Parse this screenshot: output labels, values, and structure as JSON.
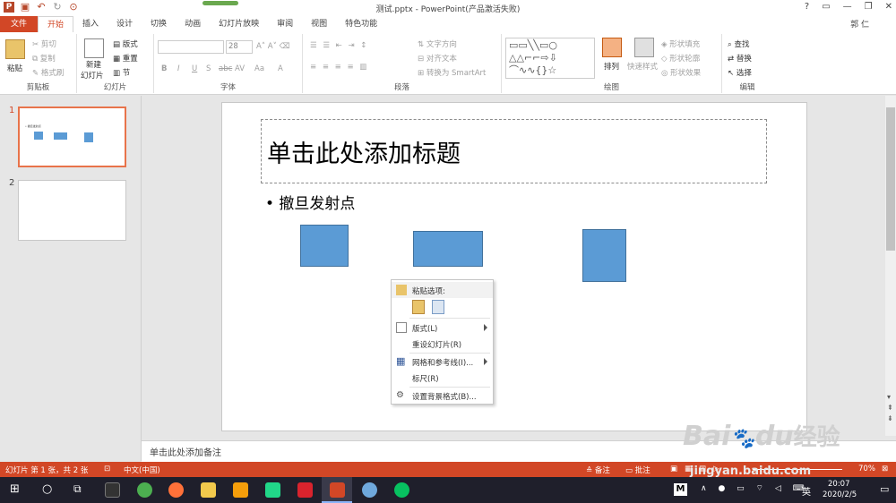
{
  "window": {
    "title": "测试.pptx - PowerPoint(产品激活失败)",
    "user": "郭 仁",
    "help": "?",
    "minimize": "—",
    "restore": "❐",
    "close": "✕"
  },
  "tabs": [
    "文件",
    "开始",
    "插入",
    "设计",
    "切换",
    "动画",
    "幻灯片放映",
    "审阅",
    "视图",
    "特色功能"
  ],
  "ribbon": {
    "clipboard": {
      "label": "剪贴板",
      "paste": "粘贴",
      "cut": "剪切",
      "copy": "复制",
      "format_painter": "格式刷"
    },
    "slides": {
      "label": "幻灯片",
      "new_slide_line1": "新建",
      "new_slide_line2": "幻灯片",
      "layout": "版式",
      "reset": "重置",
      "section": "节"
    },
    "font": {
      "label": "字体",
      "font_name": "",
      "font_size": "28",
      "bold": "B",
      "italic": "I",
      "underline": "U",
      "shadow": "S",
      "strike": "abc",
      "spacing": "AV",
      "case": "Aa",
      "color": "A"
    },
    "paragraph": {
      "label": "段落",
      "text_direction": "文字方向",
      "align_text": "对齐文本",
      "smartart": "转换为 SmartArt"
    },
    "drawing": {
      "label": "绘图",
      "arrange": "排列",
      "quick_styles": "快速样式",
      "shape_fill": "形状填充",
      "shape_outline": "形状轮廓",
      "shape_effects": "形状效果"
    },
    "editing": {
      "label": "编辑",
      "find": "查找",
      "replace": "替换",
      "select": "选择"
    }
  },
  "thumbnails": [
    {
      "number": "1",
      "mini_title": "• 撤旦发射点"
    },
    {
      "number": "2"
    }
  ],
  "slide": {
    "title_placeholder": "单击此处添加标题",
    "bullet": "• 撤旦发射点"
  },
  "notes": "单击此处添加备注",
  "context_menu": {
    "paste_options": "粘贴选项:",
    "items": [
      "版式(L)",
      "重设幻灯片(R)",
      "网格和参考线(I)...",
      "标尺(R)",
      "设置背景格式(B)..."
    ]
  },
  "status": {
    "slide_info": "幻灯片 第 1 张，共 2 张",
    "language": "中文(中国)",
    "notes": "备注",
    "comments": "批注",
    "zoom": "70%"
  },
  "taskbar": {
    "time": "20:07",
    "date": "2020/2/5",
    "ime": "英",
    "ime_tile": "M"
  },
  "watermark": {
    "brand": "Bai",
    "brand_tail": "du",
    "brand_cn": "经验",
    "url": "jingyan.baidu.com"
  },
  "colors": {
    "accent": "#d24726",
    "shape_fill": "#5b9bd5",
    "shape_border": "#41719c"
  }
}
